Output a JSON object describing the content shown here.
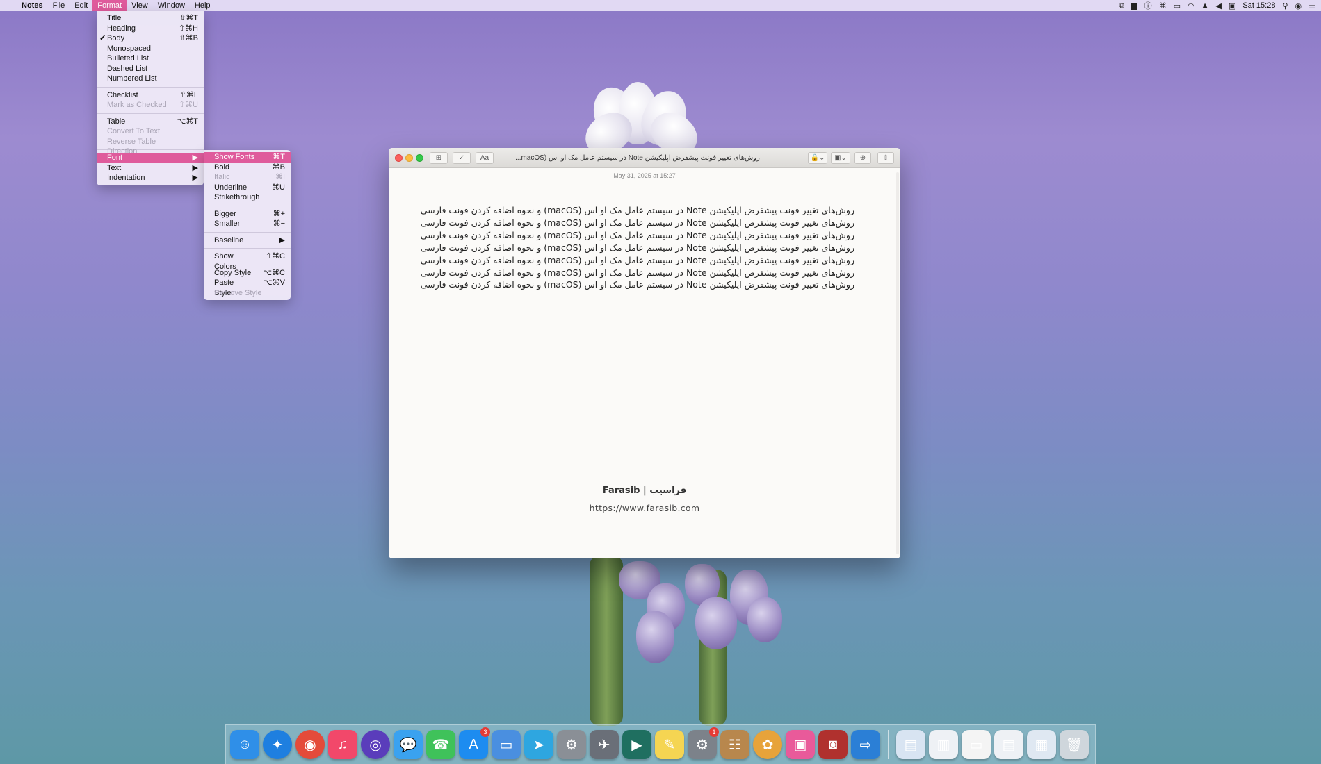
{
  "menubar": {
    "apple": "",
    "app": "Notes",
    "items": [
      "File",
      "Edit",
      "Format",
      "View",
      "Window",
      "Help"
    ],
    "clock": "Sat 15:28"
  },
  "format_menu": [
    {
      "label": "Title",
      "shortcut": "⇧⌘T"
    },
    {
      "label": "Heading",
      "shortcut": "⇧⌘H"
    },
    {
      "label": "Body",
      "shortcut": "⇧⌘B",
      "checked": "✔"
    },
    {
      "label": "Monospaced",
      "shortcut": ""
    },
    {
      "label": "Bulleted List",
      "shortcut": ""
    },
    {
      "label": "Dashed List",
      "shortcut": ""
    },
    {
      "label": "Numbered List",
      "shortcut": ""
    },
    {
      "label": "Checklist",
      "shortcut": "⇧⌘L"
    },
    {
      "label": "Mark as Checked",
      "shortcut": "⇧⌘U"
    },
    {
      "label": "Table",
      "shortcut": "⌥⌘T"
    },
    {
      "label": "Convert To Text",
      "shortcut": ""
    },
    {
      "label": "Reverse Table Direction",
      "shortcut": ""
    },
    {
      "label": "Font",
      "shortcut": "▶"
    },
    {
      "label": "Text",
      "shortcut": "▶"
    },
    {
      "label": "Indentation",
      "shortcut": "▶"
    }
  ],
  "font_menu": [
    {
      "label": "Show Fonts",
      "shortcut": "⌘T"
    },
    {
      "label": "Bold",
      "shortcut": "⌘B"
    },
    {
      "label": "Italic",
      "shortcut": "⌘I"
    },
    {
      "label": "Underline",
      "shortcut": "⌘U"
    },
    {
      "label": "Strikethrough",
      "shortcut": ""
    },
    {
      "label": "Bigger",
      "shortcut": "⌘+"
    },
    {
      "label": "Smaller",
      "shortcut": "⌘−"
    },
    {
      "label": "Baseline",
      "shortcut": "▶"
    },
    {
      "label": "Show Colors",
      "shortcut": "⇧⌘C"
    },
    {
      "label": "Copy Style",
      "shortcut": "⌥⌘C"
    },
    {
      "label": "Paste Style",
      "shortcut": "⌥⌘V"
    },
    {
      "label": "Remove Style",
      "shortcut": ""
    }
  ],
  "window": {
    "title": "روش‌های تغییر فونت پیشفرض اپلیکیشن Note در سیستم عامل مک او اس (macOS...",
    "date": "May 31, 2025 at 15:27",
    "toolbar": {
      "table": "⊞",
      "checklist": "✓",
      "format": "Aa",
      "lock": "🔒⌄",
      "media": "▣⌄",
      "collab": "⊕",
      "share": "⇧"
    },
    "note_lines": [
      "روش‌های تغییر فونت پیشفرض اپلیکیشن Note در سیستم عامل مک او اس (macOS) و نحوه اضافه کردن فونت فارسی",
      "روش‌های تغییر فونت پیشفرض اپلیکیشن Note در سیستم عامل مک او اس (macOS) و نحوه اضافه کردن فونت فارسی",
      "روش‌های تغییر فونت پیشفرض اپلیکیشن Note در سیستم عامل مک او اس (macOS) و نحوه اضافه کردن فونت فارسی",
      "روش‌های تغییر فونت پیشفرض اپلیکیشن Note در سیستم عامل مک او اس (macOS) و نحوه اضافه کردن فونت فارسی",
      "روش‌های تغییر فونت پیشفرض اپلیکیشن Note در سیستم عامل مک او اس (macOS) و نحوه اضافه کردن فونت فارسی",
      "روش‌های تغییر فونت پیشفرض اپلیکیشن Note در سیستم عامل مک او اس (macOS) و نحوه اضافه کردن فونت فارسی",
      "روش‌های تغییر فونت پیشفرض اپلیکیشن Note در سیستم عامل مک او اس (macOS) و نحوه اضافه کردن فونت فارسی"
    ],
    "brand": "Farasib | فراسیب",
    "url": "https://www.farasib.com"
  },
  "dock": [
    {
      "name": "finder",
      "glyph": "☺",
      "color": "#2f8fe8",
      "badge": ""
    },
    {
      "name": "safari",
      "glyph": "✦",
      "color": "#1e7fe0",
      "badge": ""
    },
    {
      "name": "chrome",
      "glyph": "◉",
      "color": "#e44b3a",
      "badge": ""
    },
    {
      "name": "music",
      "glyph": "♫",
      "color": "#f2486a",
      "badge": ""
    },
    {
      "name": "siri",
      "glyph": "◎",
      "color": "#5a3dbb",
      "badge": ""
    },
    {
      "name": "messages",
      "glyph": "💬",
      "color": "#3aa2f0",
      "badge": ""
    },
    {
      "name": "facetime",
      "glyph": "☎",
      "color": "#3fc25a",
      "badge": ""
    },
    {
      "name": "app-store",
      "glyph": "A",
      "color": "#1d8cf0",
      "badge": "3"
    },
    {
      "name": "keynote",
      "glyph": "▭",
      "color": "#4a8fe0",
      "badge": ""
    },
    {
      "name": "telegram",
      "glyph": "➤",
      "color": "#2ea6e0",
      "badge": ""
    },
    {
      "name": "archive-utility",
      "glyph": "⚙",
      "color": "#8a8f96",
      "badge": ""
    },
    {
      "name": "launchpad",
      "glyph": "✈",
      "color": "#6a6f78",
      "badge": ""
    },
    {
      "name": "facetime-video",
      "glyph": "▶",
      "color": "#1f6f60",
      "badge": ""
    },
    {
      "name": "notes",
      "glyph": "✎",
      "color": "#f5d552",
      "badge": ""
    },
    {
      "name": "system-preferences",
      "glyph": "⚙",
      "color": "#7c828a",
      "badge": "1"
    },
    {
      "name": "contacts",
      "glyph": "☷",
      "color": "#b8874d",
      "badge": ""
    },
    {
      "name": "photos",
      "glyph": "✿",
      "color": "#e7a33a",
      "badge": ""
    },
    {
      "name": "clean-my-mac",
      "glyph": "▣",
      "color": "#e95a9a",
      "badge": ""
    },
    {
      "name": "photo-booth",
      "glyph": "◙",
      "color": "#b0312e",
      "badge": ""
    },
    {
      "name": "migration",
      "glyph": "⇨",
      "color": "#2b7fd6",
      "badge": ""
    },
    {
      "name": "doc-1",
      "glyph": "▤",
      "color": "#d8e4f2",
      "badge": ""
    },
    {
      "name": "doc-2",
      "glyph": "▥",
      "color": "#eef1f5",
      "badge": ""
    },
    {
      "name": "doc-3",
      "glyph": "▭",
      "color": "#f4f4f4",
      "badge": ""
    },
    {
      "name": "doc-4",
      "glyph": "▤",
      "color": "#eef1f5",
      "badge": ""
    },
    {
      "name": "doc-5",
      "glyph": "▦",
      "color": "#dfe8f2",
      "badge": ""
    },
    {
      "name": "trash",
      "glyph": "🗑",
      "color": "#cfd6dc",
      "badge": ""
    }
  ]
}
